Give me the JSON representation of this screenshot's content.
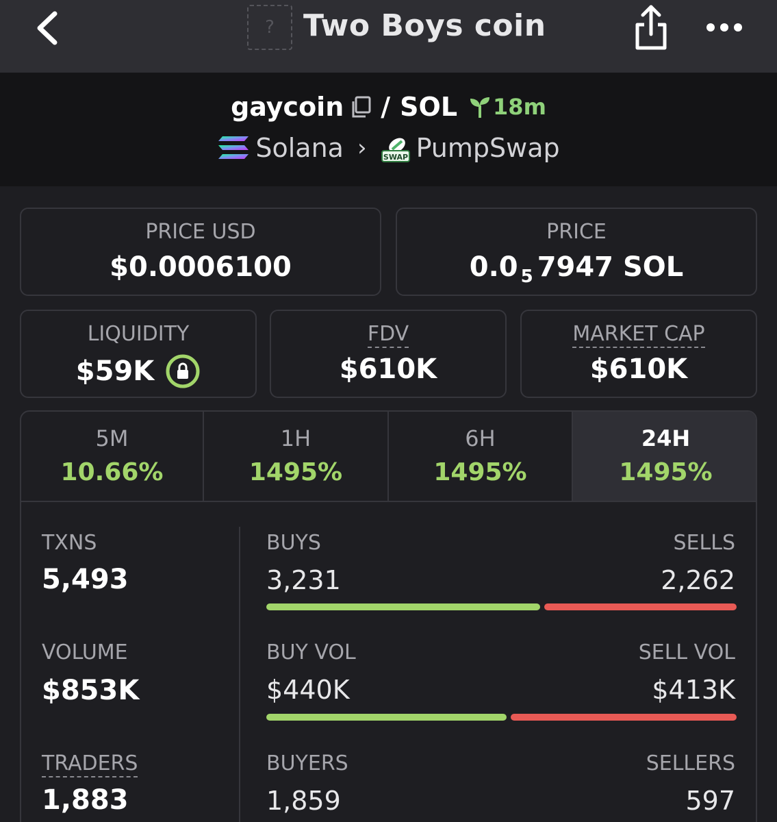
{
  "nav": {
    "title": "Two Boys coin",
    "token_image_placeholder": "?"
  },
  "pair": {
    "base": "gaycoin",
    "separator": "/",
    "quote": "SOL",
    "age": "18m",
    "chain": "Solana",
    "chain_sep": "›",
    "dex": "PumpSwap",
    "dex_badge": "SWAP"
  },
  "stats": {
    "price_usd_label": "PRICE USD",
    "price_usd": "$0.0006100",
    "price_label": "PRICE",
    "price_prefix": "0.0",
    "price_zeros": "5",
    "price_suffix": "7947 SOL",
    "liquidity_label": "LIQUIDITY",
    "liquidity": "$59K",
    "fdv_label": "FDV",
    "fdv": "$610K",
    "mcap_label": "MARKET CAP",
    "mcap": "$610K"
  },
  "tabs": [
    {
      "label": "5M",
      "value": "10.66%"
    },
    {
      "label": "1H",
      "value": "1495%"
    },
    {
      "label": "6H",
      "value": "1495%"
    },
    {
      "label": "24H",
      "value": "1495%",
      "active": true
    }
  ],
  "metrics": {
    "txns_label": "TXNS",
    "txns": "5,493",
    "volume_label": "VOLUME",
    "volume": "$853K",
    "traders_label": "TRADERS",
    "traders": "1,883",
    "buys_label": "BUYS",
    "buys": "3,231",
    "sells_label": "SELLS",
    "sells": "2,262",
    "buys_fraction": 0.588,
    "buy_vol_label": "BUY VOL",
    "buy_vol": "$440K",
    "sell_vol_label": "SELL VOL",
    "sell_vol": "$413K",
    "buy_vol_fraction": 0.516,
    "buyers_label": "BUYERS",
    "buyers": "1,859",
    "sellers_label": "SELLERS",
    "sellers": "597"
  },
  "colors": {
    "positive": "#a2d56a",
    "negative": "#e85a55",
    "age": "#8fd17a",
    "background": "#1e1e22"
  }
}
